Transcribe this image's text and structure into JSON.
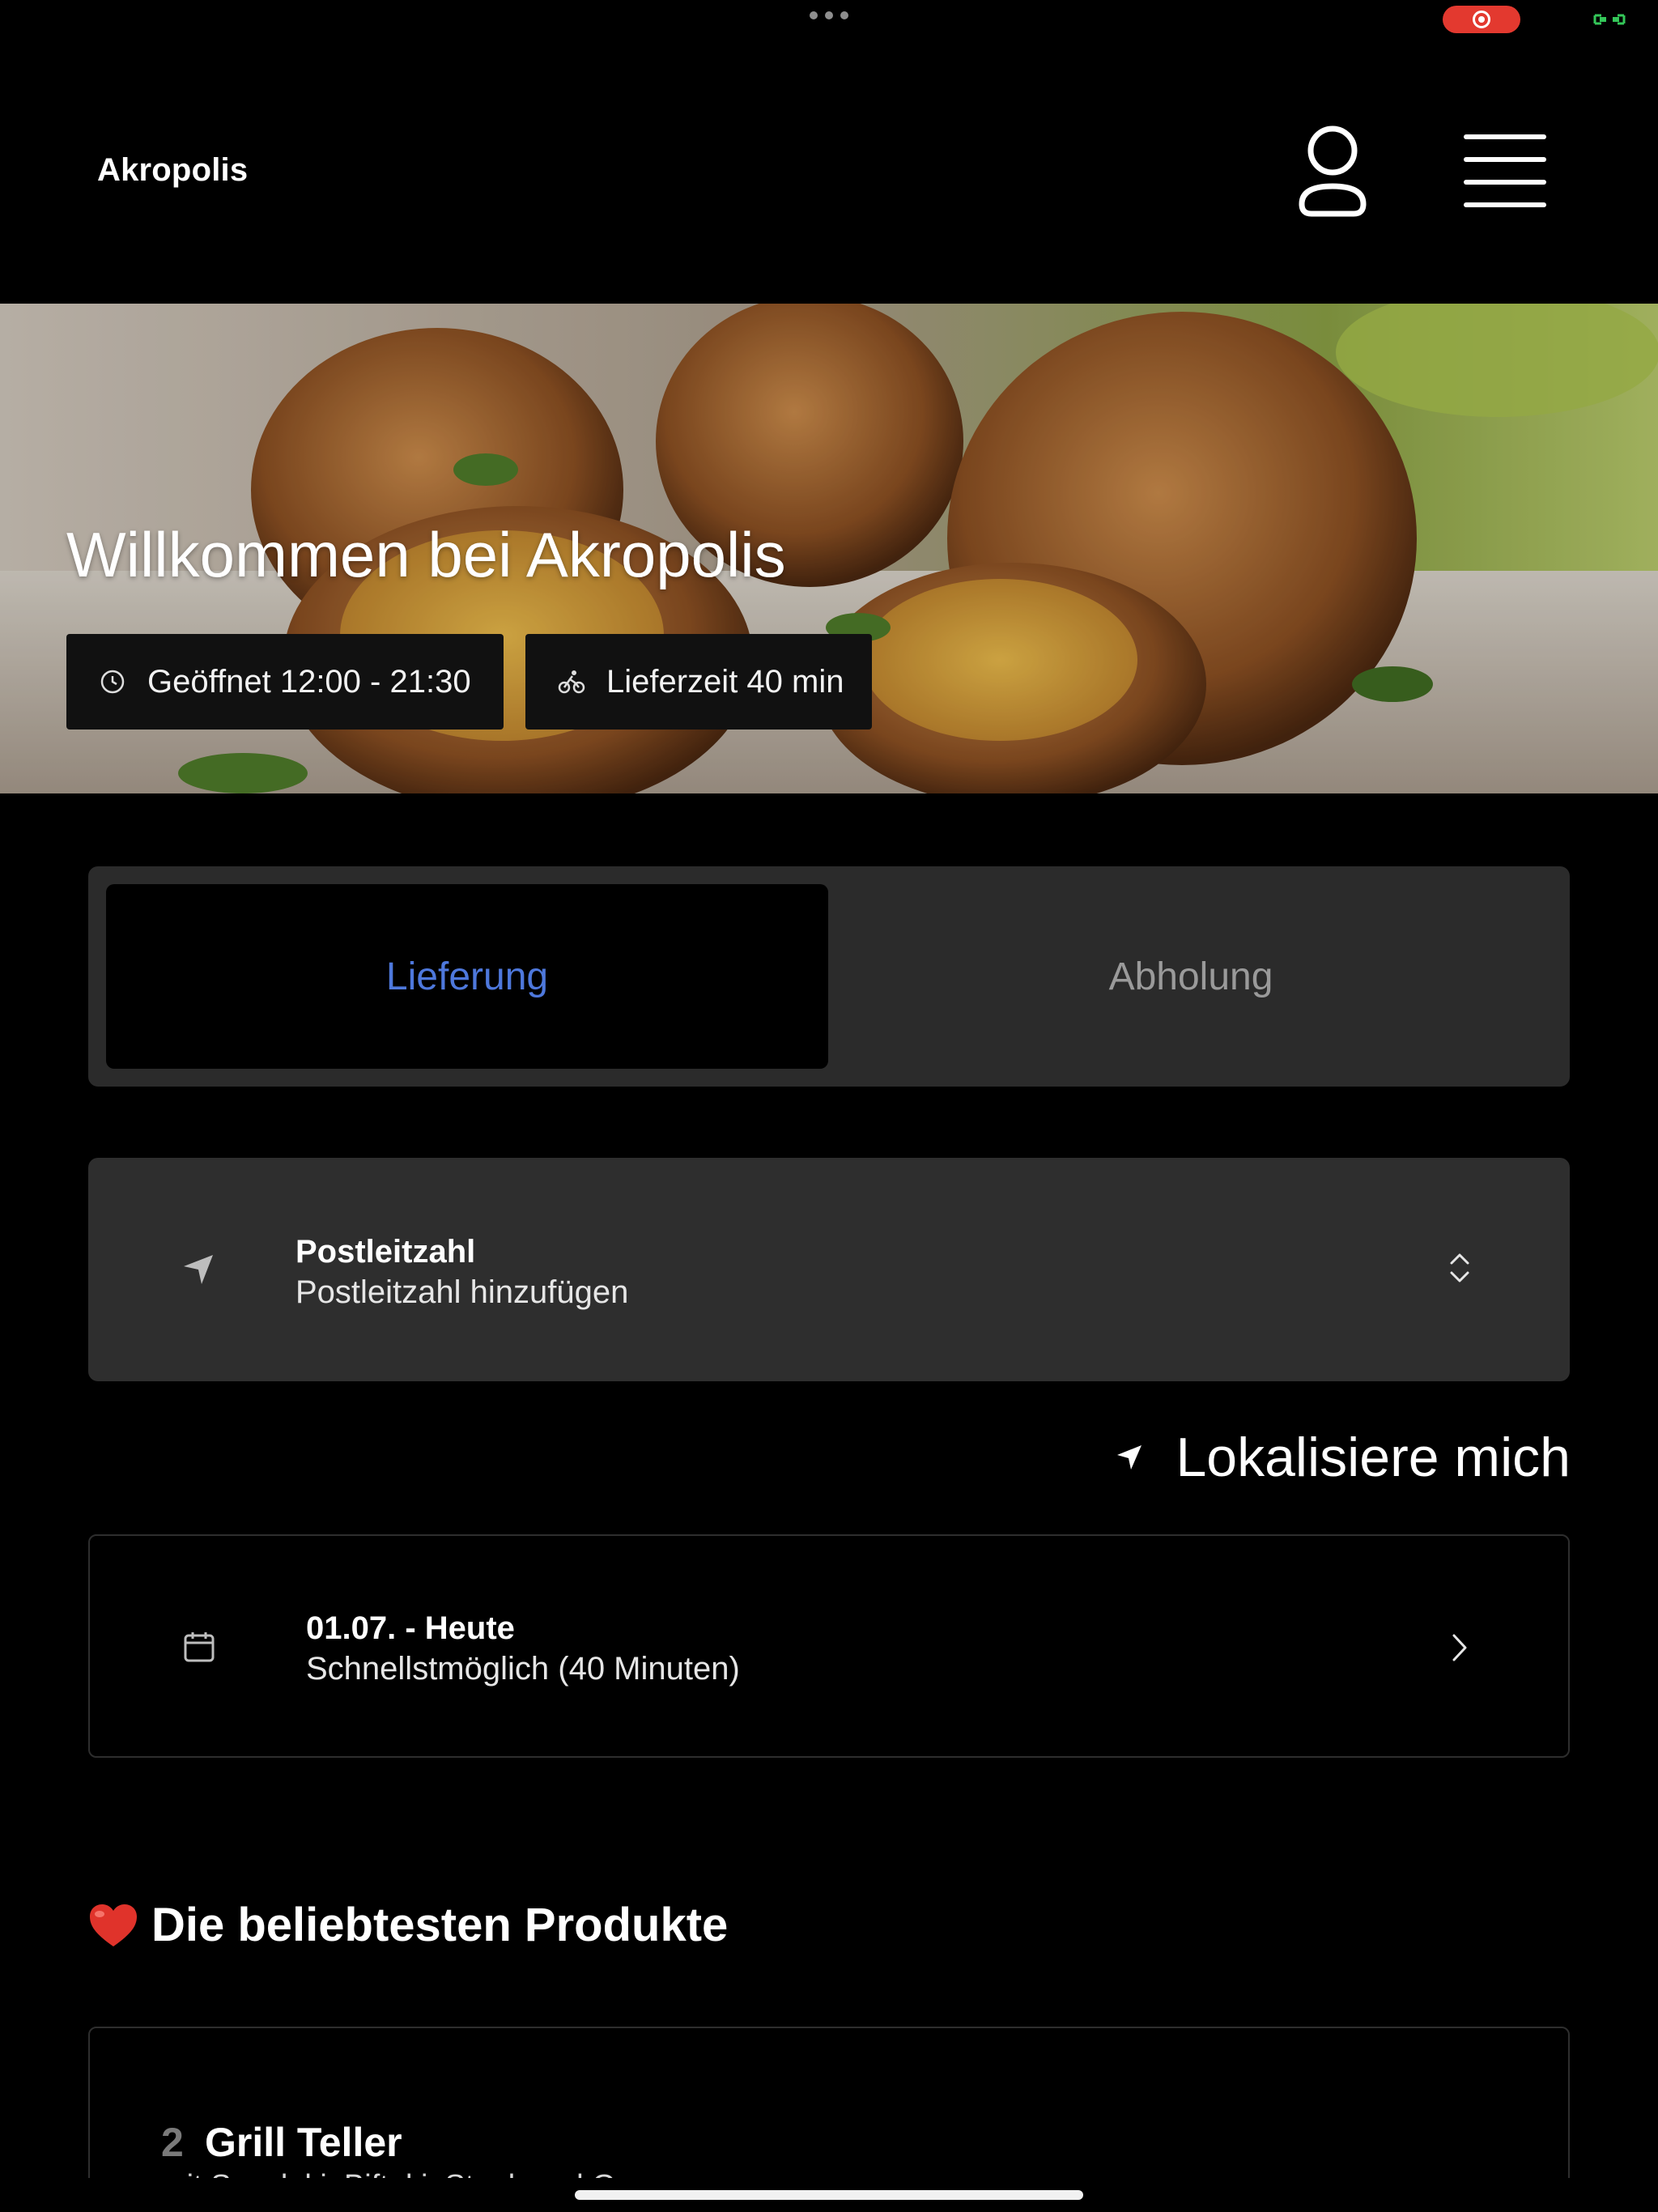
{
  "colors": {
    "accent": "#4e78dc",
    "background": "#000000",
    "surface": "#2e2e2e",
    "record": "#e3392f",
    "battery": "#34c759",
    "heart": "#e0332b"
  },
  "header": {
    "brand": "Akropolis",
    "icons": [
      "user-icon",
      "menu-icon"
    ]
  },
  "hero": {
    "title": "Willkommen bei Akropolis",
    "opening_hours": "Geöffnet 12:00 - 21:30",
    "delivery_time": "Lieferzeit 40 min",
    "icons": [
      "clock-icon",
      "bicycle-icon"
    ]
  },
  "tabs": [
    {
      "label": "Lieferung",
      "active": true
    },
    {
      "label": "Abholung",
      "active": false
    }
  ],
  "zip": {
    "title": "Postleitzahl",
    "placeholder": "Postleitzahl hinzufügen",
    "icons": [
      "navigation-arrow-icon",
      "chevron-updown-icon"
    ]
  },
  "locate": {
    "label": "Lokalisiere mich",
    "icon": "navigation-arrow-icon"
  },
  "schedule": {
    "date": "01.07. - Heute",
    "time": "Schnellstmöglich (40 Minuten)",
    "icons": [
      "calendar-icon",
      "chevron-right-icon"
    ]
  },
  "popular": {
    "heading": "Die beliebtesten Produkte",
    "icon": "heart-icon",
    "items": [
      {
        "number": "2",
        "name": "Grill Teller",
        "description": "mit Souvlaki, Bifteki, Steak und Gyros"
      }
    ]
  }
}
